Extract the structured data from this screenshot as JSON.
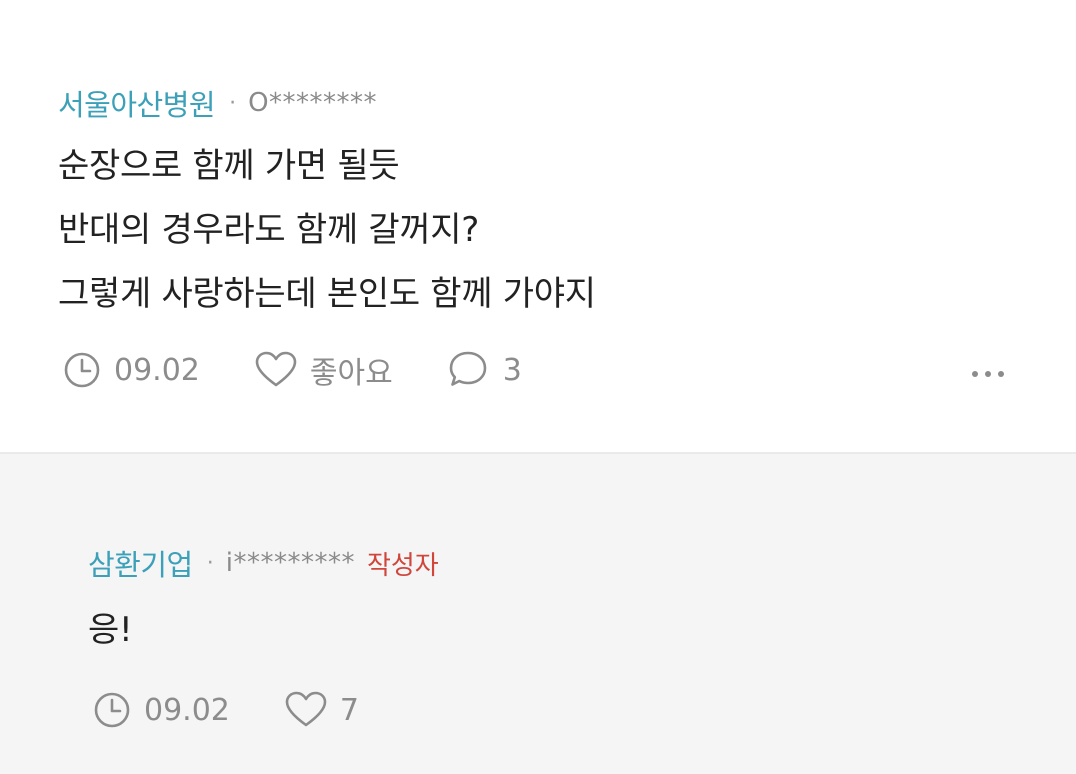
{
  "comments": [
    {
      "company": "서울아산병원",
      "separator": "·",
      "user": "O********",
      "lines": [
        "순장으로 함께 가면 될듯",
        "반대의 경우라도 함께 갈꺼지?",
        "그렇게 사랑하는데 본인도 함께 가야지"
      ],
      "date": "09.02",
      "like_label": "좋아요",
      "reply_count": "3",
      "more_icon": "more-icon"
    },
    {
      "company": "삼환기업",
      "separator": "·",
      "user": "i*********",
      "author_badge": "작성자",
      "lines": [
        "응!"
      ],
      "date": "09.02",
      "like_count": "7"
    }
  ],
  "colors": {
    "company": "#3ba0b8",
    "author_badge": "#d0463b",
    "muted": "#8c8c8c",
    "reply_bg": "#f5f5f6"
  }
}
